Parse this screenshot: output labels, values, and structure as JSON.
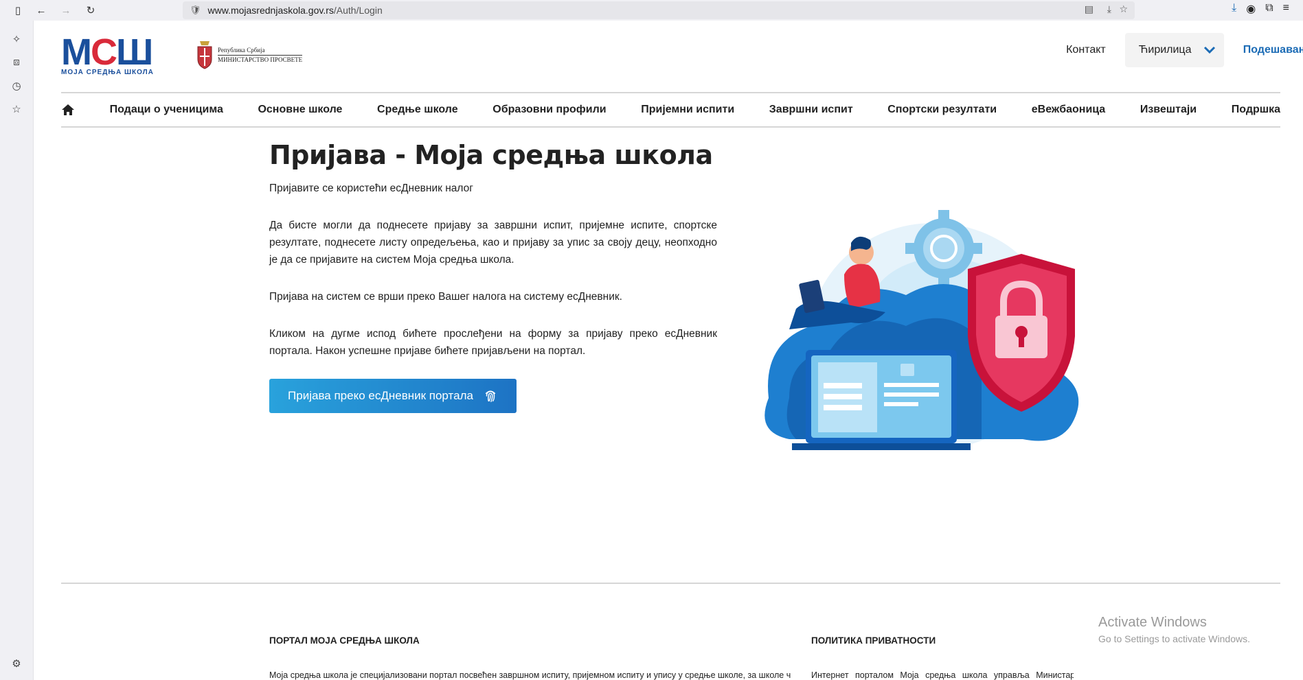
{
  "browser": {
    "url_host": "www.mojasrednjaskola.gov.rs",
    "url_path": "/Auth/Login"
  },
  "header": {
    "logo_letters": [
      "М",
      "С",
      "Ш"
    ],
    "logo_subtitle": "МОЈА СРЕДЊА ШКОЛА",
    "ministry_line1": "Република Србија",
    "ministry_line2": "МИНИСТАРСТВО ПРОСВЕТЕ",
    "contact": "Контакт",
    "language": "Ћирилица",
    "settings": "Подешавања"
  },
  "nav": {
    "items": [
      "Подаци о ученицима",
      "Основне школе",
      "Средње школе",
      "Образовни профили",
      "Пријемни испити",
      "Завршни испит",
      "Спортски резултати",
      "еВежбаоница",
      "Извештаји",
      "Подршка"
    ]
  },
  "main": {
    "title": "Пријава - Моја средња школа",
    "p1": "Пријавите се користећи есДневник налог",
    "p2": "Да бисте могли да поднесете пријаву за завршни испит, пријемне испите, спортске резултате, поднесете листу опредељења, као и пријаву за упис за своју децу, неопходно је да се пријавите на систем Моја средња школа.",
    "p3": "Пријава на систем се врши преко Вашег налога на систему есДневник.",
    "p4": "Кликом на дугме испод бићете прослеђени на форму за пријаву преко есДневник портала. Након успешне пријаве бићете пријављени на портал.",
    "login_button": "Пријава преко есДневник портала"
  },
  "footer": {
    "col1_title": "ПОРТАЛ МОЈА СРЕДЊА ШКОЛА",
    "col1_text": "Моја средња школа је специјализовани портал посвећен завршном испиту, пријемном испиту и упису у средње школе, за школе чији су",
    "col2_title": "ПОЛИТИКА ПРИВАТНОСТИ",
    "col2_text": "Интернет порталом Моја средња школа управља Министарство"
  },
  "watermark": {
    "line1": "Activate Windows",
    "line2": "Go to Settings to activate Windows."
  },
  "colors": {
    "logo_blue": "#1a4f9c",
    "logo_red": "#d92a3a",
    "accent": "#1b6bb5",
    "button_start": "#29a2dc",
    "button_end": "#1d73c4"
  }
}
